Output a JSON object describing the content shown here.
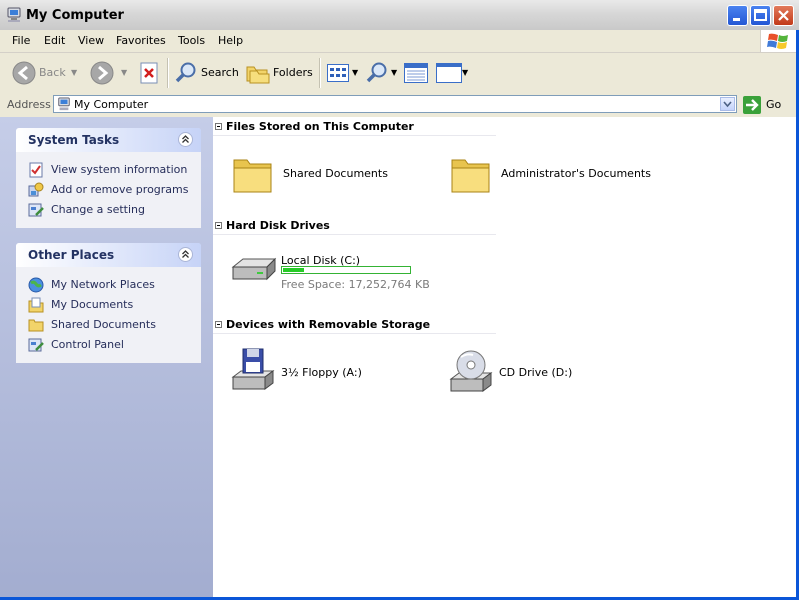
{
  "window": {
    "title": "My Computer"
  },
  "menu": [
    "File",
    "Edit",
    "View",
    "Favorites",
    "Tools",
    "Help"
  ],
  "toolbar": {
    "back": "Back",
    "search": "Search",
    "folders": "Folders"
  },
  "address": {
    "label": "Address",
    "value": "My Computer",
    "go": "Go"
  },
  "system_tasks": {
    "title": "System Tasks",
    "items": [
      "View system information",
      "Add or remove programs",
      "Change a setting"
    ]
  },
  "other_places": {
    "title": "Other Places",
    "items": [
      "My Network Places",
      "My Documents",
      "Shared Documents",
      "Control Panel"
    ]
  },
  "groups": [
    {
      "title": "Files Stored on This Computer",
      "items": [
        "Shared Documents",
        "Administrator's Documents"
      ]
    },
    {
      "title": "Hard Disk Drives",
      "items": [
        {
          "name": "Local Disk (C:)",
          "free": "Free Space: 17,252,764 KB",
          "used_fraction": 0.17
        }
      ]
    },
    {
      "title": "Devices with Removable Storage",
      "items": [
        "3½ Floppy (A:)",
        "CD Drive (D:)"
      ]
    }
  ],
  "colors": {
    "frame": "#0a56d8",
    "taskpane_text": "#262e5a",
    "free_bar": "#27cc27"
  }
}
